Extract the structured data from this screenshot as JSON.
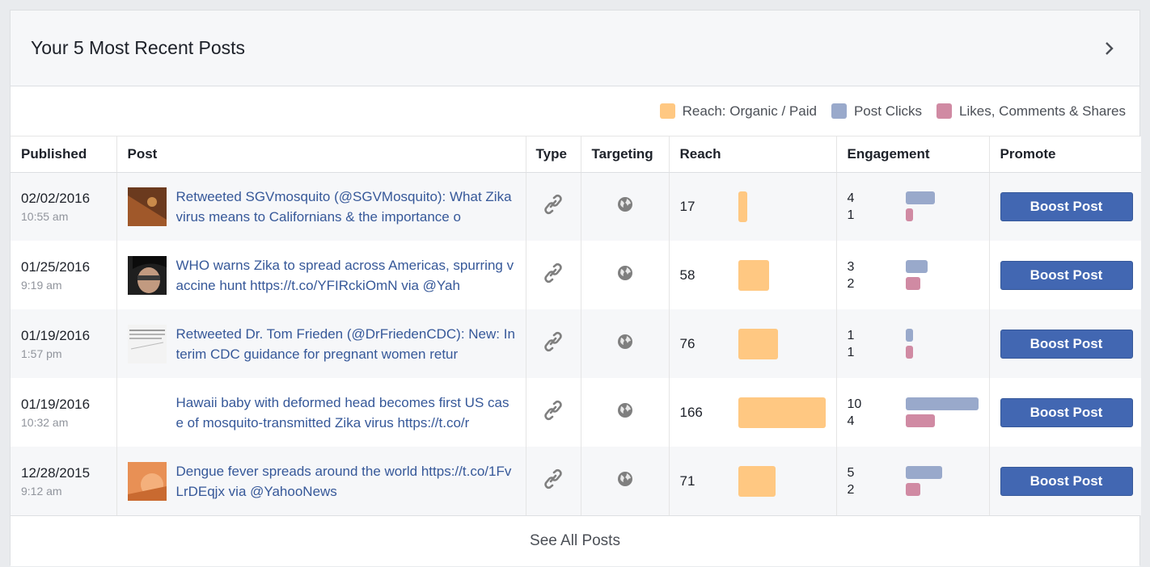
{
  "header": {
    "title": "Your 5 Most Recent Posts"
  },
  "legend": [
    {
      "label": "Reach: Organic / Paid",
      "color": "#ffc882"
    },
    {
      "label": "Post Clicks",
      "color": "#99a9cb"
    },
    {
      "label": "Likes, Comments & Shares",
      "color": "#d08aa3"
    }
  ],
  "columns": [
    "Published",
    "Post",
    "Type",
    "Targeting",
    "Reach",
    "Engagement",
    "Promote"
  ],
  "rows": [
    {
      "date": "02/02/2016",
      "time": "10:55 am",
      "text": "Retweeted SGVmosquito (@SGVMosquito): What Zika virus means to Californians & the importance o",
      "thumb": "brown",
      "reach": 17,
      "clicks": 4,
      "likes": 1,
      "boost": "Boost Post"
    },
    {
      "date": "01/25/2016",
      "time": "9:19 am",
      "text": "WHO warns Zika to spread across Americas, spurring vaccine hunt https://t.co/YFIRckiOmN via @Yah",
      "thumb": "face",
      "reach": 58,
      "clicks": 3,
      "likes": 2,
      "boost": "Boost Post"
    },
    {
      "date": "01/19/2016",
      "time": "1:57 pm",
      "text": "Retweeted Dr. Tom Frieden (@DrFriedenCDC): New: Interim CDC guidance for pregnant women retur",
      "thumb": "doc",
      "reach": 76,
      "clicks": 1,
      "likes": 1,
      "boost": "Boost Post"
    },
    {
      "date": "01/19/2016",
      "time": "10:32 am",
      "text": "Hawaii baby with deformed head becomes first US case of mosquito-transmitted Zika virus https://t.co/r",
      "thumb": "none",
      "reach": 166,
      "clicks": 10,
      "likes": 4,
      "boost": "Boost Post"
    },
    {
      "date": "12/28/2015",
      "time": "9:12 am",
      "text": "Dengue fever spreads around the world https://t.co/1FvLrDEqjx via @YahooNews",
      "thumb": "orange",
      "reach": 71,
      "clicks": 5,
      "likes": 2,
      "boost": "Boost Post"
    }
  ],
  "footer": {
    "label": "See All Posts"
  },
  "icons": {
    "type": "link-icon",
    "targeting": "globe-icon",
    "next": "chevron-right-icon"
  }
}
